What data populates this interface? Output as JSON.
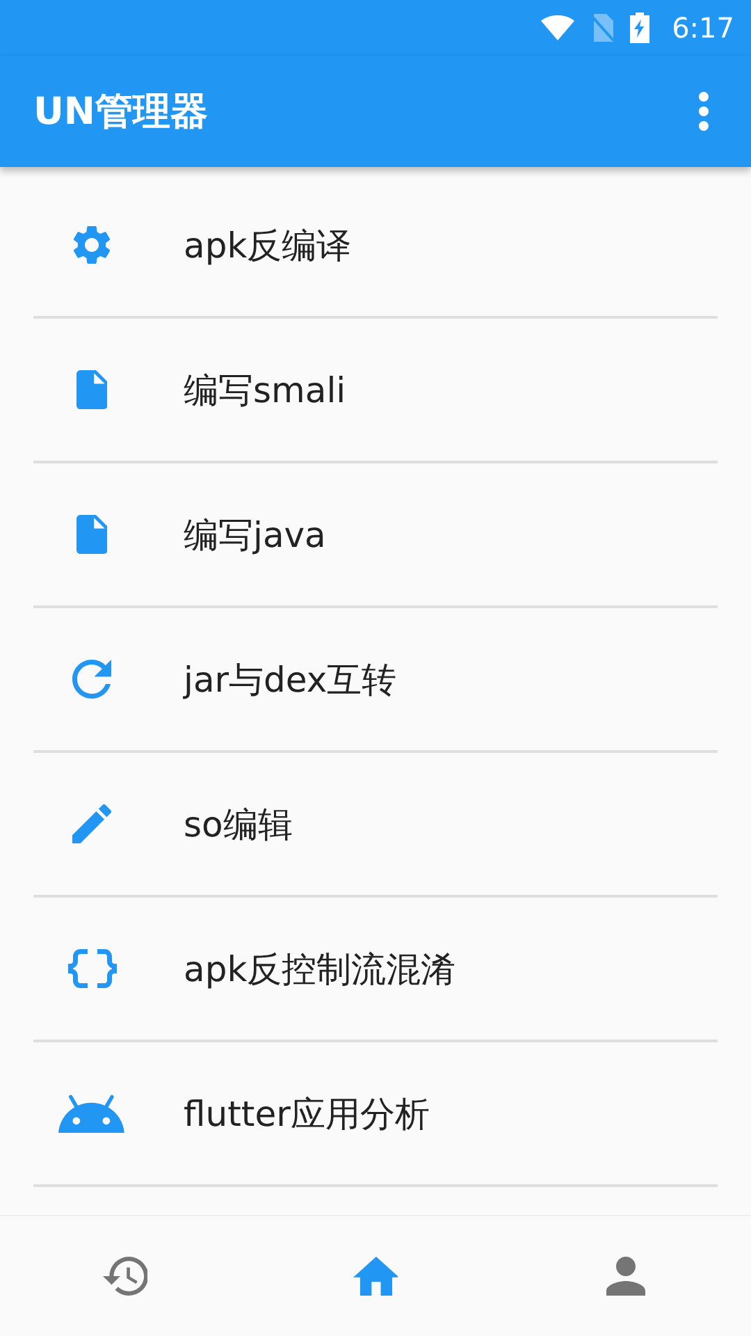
{
  "status_bar": {
    "time": "6:17"
  },
  "app_bar": {
    "title": "UN管理器"
  },
  "items": [
    {
      "label": "apk反编译",
      "kind": "gear"
    },
    {
      "label": "编写smali",
      "kind": "file"
    },
    {
      "label": "编写java",
      "kind": "file"
    },
    {
      "label": "jar与dex互转",
      "kind": "refresh"
    },
    {
      "label": "so编辑",
      "kind": "pencil"
    },
    {
      "label": "apk反控制流混淆",
      "kind": "braces"
    },
    {
      "label": "flutter应用分析",
      "kind": "android"
    }
  ],
  "bottom_nav": [
    {
      "kind": "history",
      "selected": false
    },
    {
      "kind": "home",
      "selected": true
    },
    {
      "kind": "person",
      "selected": false
    }
  ]
}
